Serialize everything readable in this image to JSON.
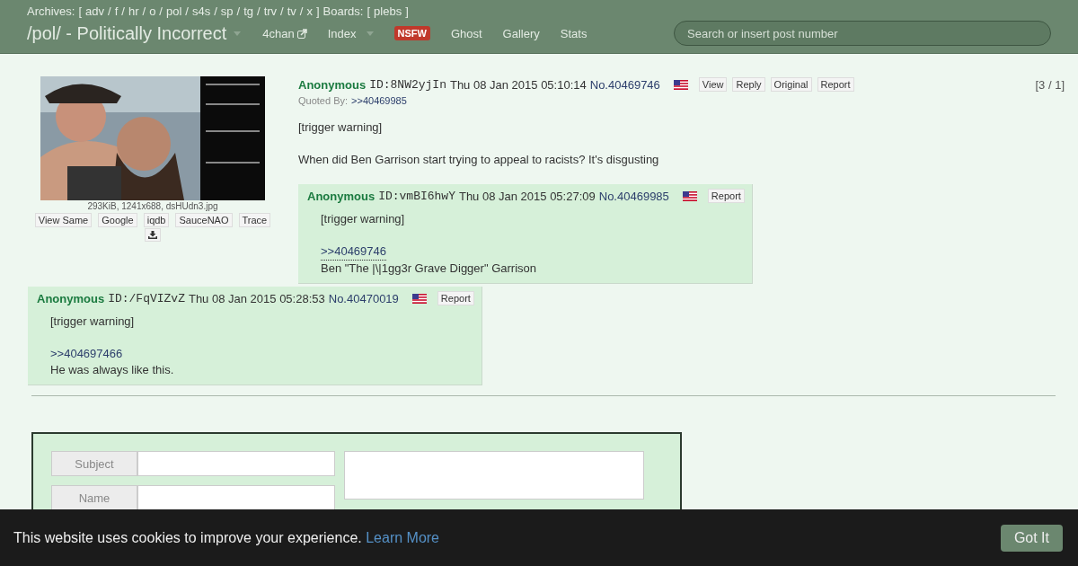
{
  "top_bar": {
    "archives_label": "Archives:",
    "brackets": [
      "[",
      "]"
    ],
    "separator": "/",
    "archives": [
      "adv",
      "f",
      "hr",
      "o",
      "pol",
      "s4s",
      "sp",
      "tg",
      "trv",
      "tv",
      "x"
    ],
    "boards_label": "Boards:",
    "boards": [
      "plebs"
    ]
  },
  "header": {
    "title": "/pol/ - Politically Incorrect",
    "nav": [
      {
        "label": "4chan",
        "kind": "external"
      },
      {
        "label": "Index",
        "kind": "dropdown"
      },
      {
        "label": "NSFW",
        "kind": "badge"
      },
      {
        "label": "Ghost",
        "kind": "link"
      },
      {
        "label": "Gallery",
        "kind": "link"
      },
      {
        "label": "Stats",
        "kind": "link"
      }
    ],
    "search": {
      "placeholder": "Search or insert post number"
    }
  },
  "op": {
    "thumbnail": {
      "kind": "picture"
    },
    "file_info": "293KiB, 1241x688, dsHUdn3.jpg",
    "image_search": [
      "View Same",
      "Google",
      "iqdb",
      "SauceNAO",
      "Trace"
    ],
    "name": "Anonymous",
    "poster_id": "ID:8NW2yjIn",
    "date": "Thu 08 Jan 2015 05:10:14",
    "number": "No.40469746",
    "actions": [
      "View",
      "Reply",
      "Original",
      "Report"
    ],
    "counter": "[3 / 1]",
    "quoted_by_label": "Quoted By:",
    "quoted_by": [
      ">>40469985"
    ],
    "body": [
      [
        {
          "kind": "text",
          "text": "[trigger warning]"
        }
      ],
      [
        {
          "kind": "text",
          "text": "When did Ben Garrison start trying to appeal to racists? It's disgusting"
        }
      ]
    ]
  },
  "replies": [
    {
      "name": "Anonymous",
      "poster_id": "ID:vmBI6hwY",
      "date": "Thu 08 Jan 2015 05:27:09",
      "number": "No.40469985",
      "actions": [
        "Report"
      ],
      "body": [
        [
          {
            "kind": "text",
            "text": "[trigger warning]"
          }
        ],
        [
          {
            "kind": "backlink",
            "text": ">>40469746"
          },
          {
            "kind": "text",
            "text": "Ben \"The |\\|1gg3r Grave Digger\" Garrison"
          }
        ]
      ]
    },
    {
      "name": "Anonymous",
      "poster_id": "ID:/FqVIZvZ",
      "date": "Thu 08 Jan 2015 05:28:53",
      "number": "No.40470019",
      "actions": [
        "Report"
      ],
      "body": [
        [
          {
            "kind": "text",
            "text": "[trigger warning]"
          }
        ],
        [
          {
            "kind": "deadlink",
            "text": ">>404697466"
          },
          {
            "kind": "text",
            "text": "He was always like this."
          }
        ]
      ]
    }
  ],
  "reply_form": {
    "fields": [
      {
        "label": "Subject"
      },
      {
        "label": "Name"
      }
    ]
  },
  "cookie_banner": {
    "message": "This website uses cookies to improve your experience.",
    "link": "Learn More",
    "button": "Got It"
  }
}
